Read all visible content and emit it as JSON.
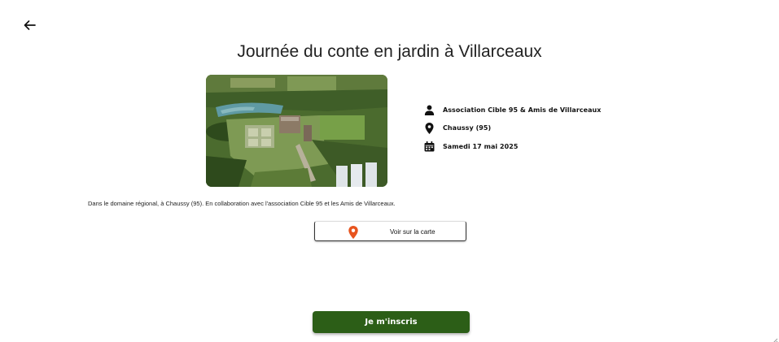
{
  "event": {
    "title": "Journée du conte en jardin à Villarceaux",
    "organizer": "Association Cible 95 & Amis de Villarceaux",
    "location": "Chaussy (95)",
    "date": "Samedi 17 mai 2025",
    "description": "Dans le domaine régional, à Chaussy (95). En collaboration avec l'association Cible 95 et les Amis de Villarceaux."
  },
  "actions": {
    "map_label": "Voir sur la carte",
    "register_label": "Je m'inscris"
  },
  "icons": {
    "back": "arrow-left-icon",
    "organizer": "person-icon",
    "location": "location-pin-icon",
    "date": "calendar-icon",
    "map": "map-pin-icon"
  },
  "colors": {
    "primary": "#2c5e17",
    "map_pin": "#e8541e",
    "text": "#222222"
  }
}
